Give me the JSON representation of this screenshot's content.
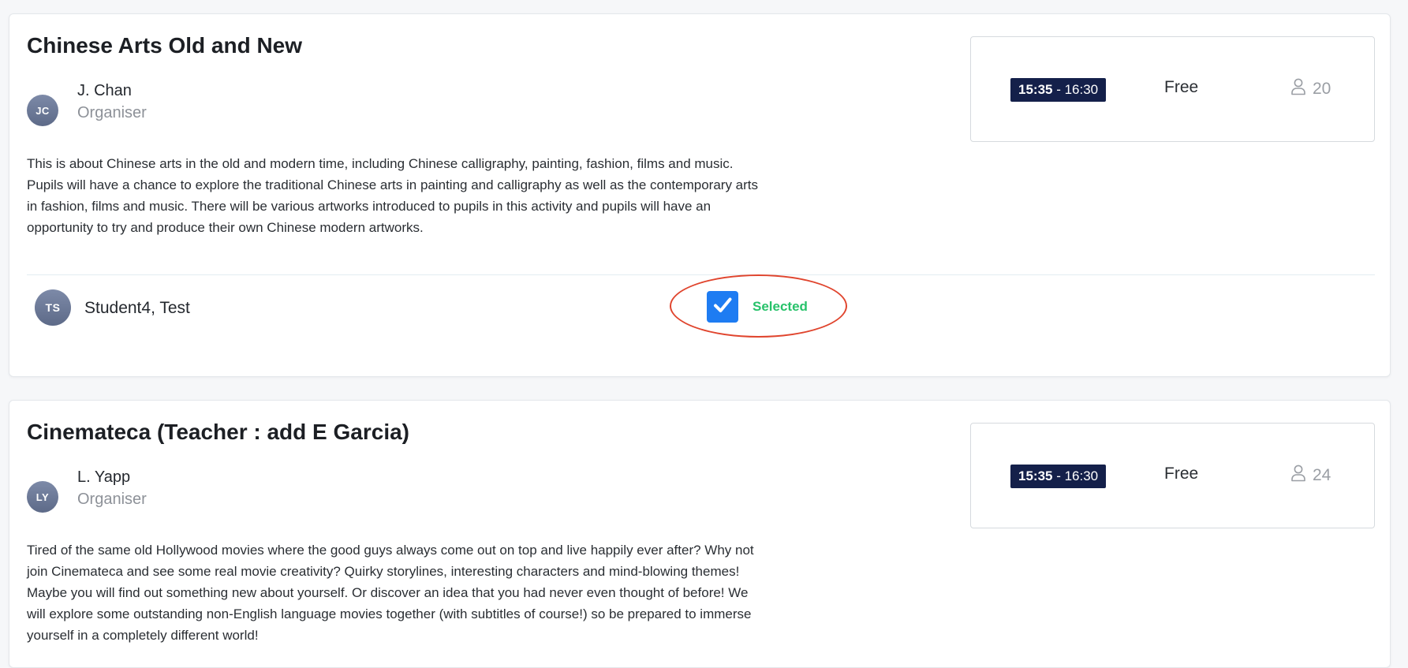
{
  "activities": [
    {
      "title": "Chinese Arts Old and New",
      "organiser": {
        "initials": "JC",
        "name": "J. Chan",
        "role": "Organiser"
      },
      "description": "This is about Chinese arts in the old and modern time, including Chinese calligraphy, painting, fashion, films and music. Pupils will have a chance to explore the traditional Chinese arts in painting and calligraphy as well as the contemporary arts in fashion, films and music. There will be various artworks introduced to pupils in this activity and pupils will have an opportunity to try and produce their own Chinese modern artworks.",
      "time_start": "15:35",
      "time_sep": " - ",
      "time_end": "16:30",
      "price": "Free",
      "capacity": "20",
      "student": {
        "initials": "TS",
        "name": "Student4, Test",
        "status": "Selected",
        "checked": true
      }
    },
    {
      "title": "Cinemateca (Teacher : add E Garcia)",
      "organiser": {
        "initials": "LY",
        "name": "L. Yapp",
        "role": "Organiser"
      },
      "description": "Tired of the same old Hollywood movies where the good guys always come out on top and live happily ever after? Why not join Cinemateca and see some real movie creativity? Quirky storylines, interesting characters and mind-blowing themes! Maybe you will find out something new about yourself. Or discover an idea that you had never even thought of before! We will explore some outstanding non-English language movies together (with subtitles of course!) so be prepared to immerse yourself in a completely different world!",
      "time_start": "15:35",
      "time_sep": " - ",
      "time_end": "16:30",
      "price": "Free",
      "capacity": "24"
    }
  ],
  "icons": {
    "capacity": "person-outline-icon",
    "checkbox": "checkmark-icon"
  },
  "colors": {
    "time_badge_bg": "#14204a",
    "checkbox_bg": "#1e7cf2",
    "selected_text": "#27c26a",
    "highlight_oval": "#e0452e",
    "avatar": "#6b7896"
  }
}
